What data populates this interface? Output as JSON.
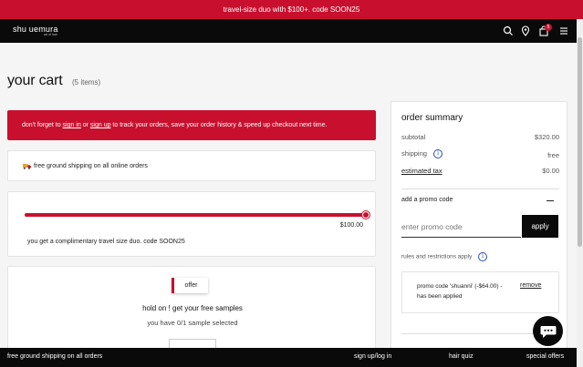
{
  "promo_banner": {
    "text": "travel-size duo with $100+. code SOON25"
  },
  "navbar": {
    "logo": "shu uemura",
    "logo_sub": "art of hair",
    "cart_count": "5",
    "icons": [
      "search-icon",
      "location-pin-icon",
      "shopping-bag-icon",
      "menu-icon"
    ]
  },
  "cart": {
    "title": "your cart",
    "count_label": "(5 items)",
    "signin_banner": {
      "prefix": "don't forget to ",
      "signin_link": "sign in",
      "middle": " or ",
      "signup_link": "sign up",
      "suffix": " to track your orders, save your order history & speed up checkout next time."
    },
    "shipping_notice": {
      "icon": "delivery-truck-icon",
      "text": "free ground shipping on all online orders"
    },
    "progress": {
      "progress_fraction": 1.0,
      "threshold_label": "$100.00",
      "message": "you get a complimentary travel size duo. code SOON25"
    },
    "samples": {
      "tab_label": "offer",
      "heading": "hold on ! get your free samples",
      "subtext": "you have 0/1 sample selected"
    }
  },
  "summary": {
    "title": "order summary",
    "subtotal_label": "subtotal",
    "subtotal_value": "$320.00",
    "shipping_label": "shipping",
    "shipping_value": "free",
    "tax_label": "estimated tax",
    "tax_value": "$0.00",
    "promo_section_label": "add a promo code",
    "promo_input_placeholder": "enter promo code",
    "apply_label": "apply",
    "rules_label": "rules and restrictions apply",
    "applied_text": "promo code 'shuanni' (-$64.00) - has been applied",
    "remove_label": "remove"
  },
  "footer": {
    "shipping_text": "free ground shipping on all orders",
    "signin": "sign up/log in",
    "hair_quiz": "hair quiz",
    "special_offers": "special offers"
  },
  "colors": {
    "brand_red": "#c8102e",
    "black": "#0a0a0a",
    "link_blue": "#2a4db0"
  }
}
